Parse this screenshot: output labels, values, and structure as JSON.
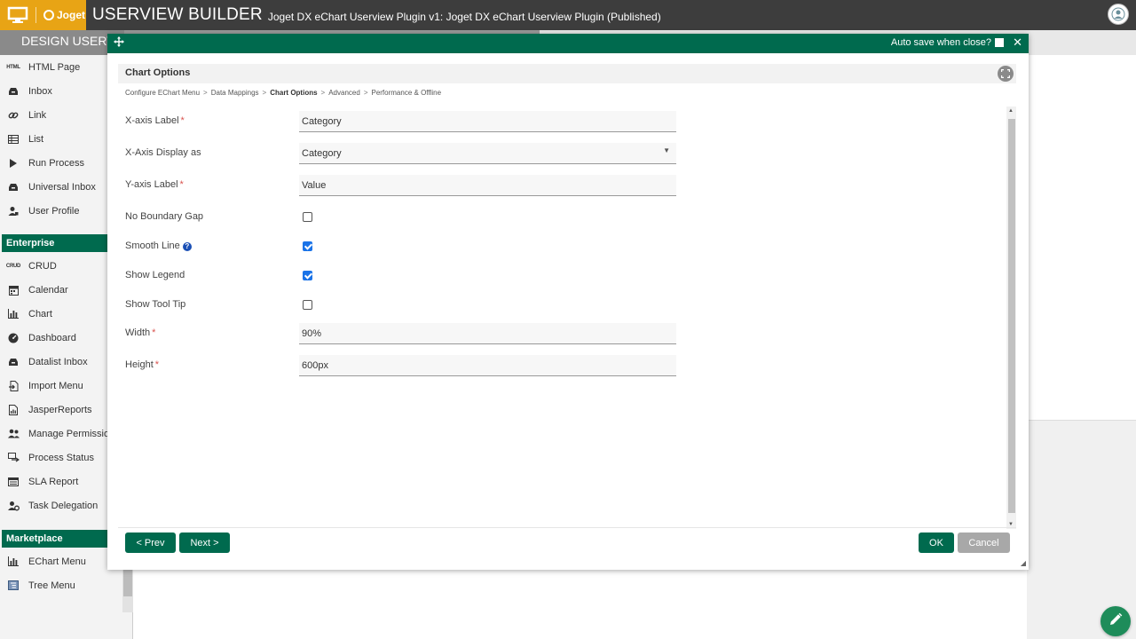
{
  "topbar": {
    "logo_text": "Joget",
    "builder_title": "USERVIEW BUILDER",
    "app_title": "Joget DX eChart Userview Plugin v1: Joget DX eChart Userview Plugin (Published)"
  },
  "subbar": {
    "design_tab": "DESIGN USERVIEW"
  },
  "sidebar": {
    "items": [
      {
        "label": "HTML Page",
        "icon": "html-icon"
      },
      {
        "label": "Inbox",
        "icon": "inbox-icon"
      },
      {
        "label": "Link",
        "icon": "link-icon"
      },
      {
        "label": "List",
        "icon": "list-icon"
      },
      {
        "label": "Run Process",
        "icon": "play-icon"
      },
      {
        "label": "Universal Inbox",
        "icon": "inbox-icon"
      },
      {
        "label": "User Profile",
        "icon": "user-icon"
      }
    ],
    "enterprise_header": "Enterprise",
    "enterprise_items": [
      {
        "label": "CRUD",
        "icon": "crud-icon"
      },
      {
        "label": "Calendar",
        "icon": "calendar-icon"
      },
      {
        "label": "Chart",
        "icon": "chart-icon"
      },
      {
        "label": "Dashboard",
        "icon": "dashboard-icon"
      },
      {
        "label": "Datalist Inbox",
        "icon": "inbox-icon"
      },
      {
        "label": "Import Menu",
        "icon": "import-icon"
      },
      {
        "label": "JasperReports",
        "icon": "report-icon"
      },
      {
        "label": "Manage Permission",
        "icon": "users-icon"
      },
      {
        "label": "Process Status",
        "icon": "status-icon"
      },
      {
        "label": "SLA Report",
        "icon": "table-icon"
      },
      {
        "label": "Task Delegation",
        "icon": "user-gear-icon"
      }
    ],
    "marketplace_header": "Marketplace",
    "marketplace_items": [
      {
        "label": "EChart Menu",
        "icon": "chart-icon"
      },
      {
        "label": "Tree Menu",
        "icon": "tree-icon"
      }
    ]
  },
  "modal": {
    "autosave_label": "Auto save when close?",
    "section_title": "Chart Options",
    "breadcrumb": [
      "Configure EChart Menu",
      "Data Mappings",
      "Chart Options",
      "Advanced",
      "Performance & Offline"
    ],
    "fields": {
      "x_axis_label": {
        "label": "X-axis Label",
        "value": "Category"
      },
      "x_axis_display": {
        "label": "X-Axis Display as",
        "value": "Category"
      },
      "y_axis_label": {
        "label": "Y-axis Label",
        "value": "Value"
      },
      "no_boundary_gap": {
        "label": "No Boundary Gap",
        "checked": false
      },
      "smooth_line": {
        "label": "Smooth Line",
        "checked": true
      },
      "show_legend": {
        "label": "Show Legend",
        "checked": true
      },
      "show_tool_tip": {
        "label": "Show Tool Tip",
        "checked": false
      },
      "width": {
        "label": "Width",
        "value": "90%"
      },
      "height": {
        "label": "Height",
        "value": "600px"
      }
    },
    "required_mark": "*",
    "help_mark": "?",
    "buttons": {
      "prev": "< Prev",
      "next": "Next >",
      "ok": "OK",
      "cancel": "Cancel"
    }
  }
}
